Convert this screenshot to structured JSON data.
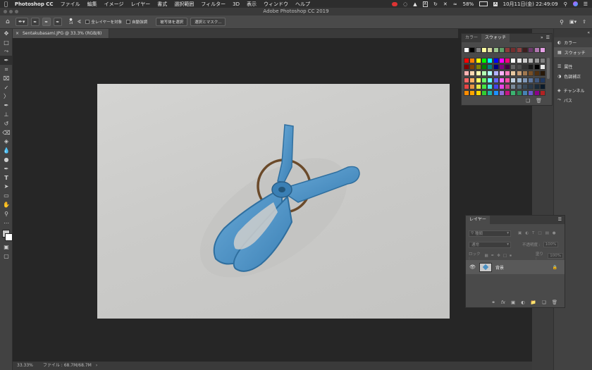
{
  "menubar": {
    "app_name": "Photoshop CC",
    "items": [
      "ファイル",
      "編集",
      "イメージ",
      "レイヤー",
      "書式",
      "選択範囲",
      "フィルター",
      "3D",
      "表示",
      "ウィンドウ",
      "ヘルプ"
    ],
    "battery": "58%",
    "datetime": "10月11日(金)  22:49:09"
  },
  "window": {
    "title": "Adobe Photoshop CC 2019"
  },
  "options_bar": {
    "brush_size": "14",
    "sample_all_layers": "全レイヤーを対象",
    "auto_enhance": "自動強調",
    "select_subject": "被写体を選択",
    "select_and_mask": "選択とマスク..."
  },
  "document": {
    "tab_title": "Sentakubasami.JPG @ 33.3% (RGB/8)",
    "zoom": "33.33%",
    "file_info": "ファイル : 68.7M/68.7M"
  },
  "swatches_panel": {
    "tabs": [
      "カラー",
      "スウォッチ"
    ],
    "active_tab": "スウォッチ",
    "top_row": [
      "#ffffff",
      "#000000",
      "#808080",
      "#ffff9f",
      "#d7d7a1",
      "#9dc58e",
      "#5f9e66",
      "#8c3a3a",
      "#732f2f",
      "#8c4040",
      "#3d1e1e",
      "#6b3a6b",
      "#b077b0",
      "#e6a0e6"
    ],
    "grid": [
      [
        "#ff0000",
        "#ff8000",
        "#ffff00",
        "#00ff00",
        "#00ffff",
        "#0000ff",
        "#ff00ff",
        "#ff0080",
        "#ffffff",
        "#e6e6e6",
        "#cccccc",
        "#b3b3b3",
        "#999999",
        "#808080"
      ],
      [
        "#800000",
        "#804000",
        "#808000",
        "#008000",
        "#008080",
        "#000080",
        "#800080",
        "#400040",
        "#666666",
        "#4d4d4d",
        "#333333",
        "#1a1a1a",
        "#000000",
        "#e6e6e6"
      ],
      [
        "#ffb3b3",
        "#ffd9b3",
        "#ffffb3",
        "#b3ffb3",
        "#b3ffff",
        "#b3b3ff",
        "#ffb3ff",
        "#ff80c0",
        "#e6c8a0",
        "#c8a078",
        "#a07850",
        "#785028",
        "#503010",
        "#281808"
      ],
      [
        "#ff6666",
        "#ffb366",
        "#ffff66",
        "#66ff66",
        "#66ffff",
        "#6666ff",
        "#ff66ff",
        "#ff4da6",
        "#c0d0e0",
        "#a0b8d0",
        "#8098b8",
        "#6078a0",
        "#405880",
        "#203860"
      ],
      [
        "#e64545",
        "#e69545",
        "#e6e645",
        "#45e645",
        "#45e6e6",
        "#4545e6",
        "#e645e6",
        "#c83c8c",
        "#7a8a9a",
        "#5a6a7a",
        "#3a4a5a",
        "#2a3a4a",
        "#1a2a3a",
        "#0a1a2a"
      ],
      [
        "#ff8c00",
        "#ffa500",
        "#ffd700",
        "#32cd32",
        "#20b2aa",
        "#1e90ff",
        "#9370db",
        "#c71585",
        "#3cb371",
        "#2e8b57",
        "#4682b4",
        "#6a5acd",
        "#8b008b",
        "#b22222"
      ]
    ]
  },
  "right_dock": {
    "items": [
      {
        "label": "カラー",
        "icon": "color-wheel-icon"
      },
      {
        "label": "スウォッチ",
        "icon": "swatch-grid-icon"
      },
      {
        "label": "属性",
        "icon": "properties-icon"
      },
      {
        "label": "色調補正",
        "icon": "adjustments-icon"
      },
      {
        "label": "チャンネル",
        "icon": "channels-icon"
      },
      {
        "label": "パス",
        "icon": "paths-icon"
      }
    ],
    "active_index": 1
  },
  "layers_panel": {
    "tab": "レイヤー",
    "filter_kind": "種類",
    "blend_mode": "通常",
    "opacity_label": "不透明度 :",
    "opacity_value": "100%",
    "lock_label": "ロック :",
    "fill_label": "塗り :",
    "fill_value": "100%",
    "layers": [
      {
        "name": "背景",
        "visible": true,
        "locked": true
      }
    ]
  },
  "colors": {
    "menubar": "#2d2d2d",
    "panel": "#424242",
    "canvas_bg": "#262626",
    "photo_bg": "#cfcfcd",
    "clip_blue": "#4a90c2",
    "ring_brown": "#6b4a2a"
  }
}
